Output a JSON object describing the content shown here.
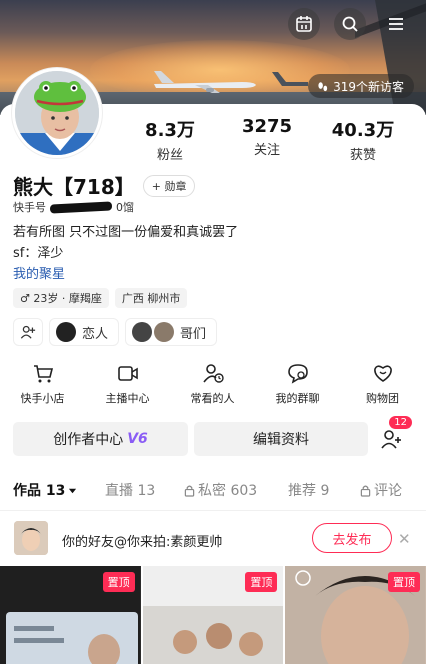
{
  "header": {
    "visitors_label": "319个新访客"
  },
  "profile": {
    "name": "熊大【718】",
    "medal_label": "+ 勋章",
    "kuaishou_id_prefix": "快手号",
    "kuaishou_id_suffix": "0馏",
    "bio_line1": "若有所图 只不过图一份偏爱和真诚罢了",
    "bio_line2": "sf：泽少",
    "my_collection": "我的聚星",
    "tags": [
      "♂ 23岁 · 摩羯座",
      "广西 柳州市"
    ],
    "friend_chips": [
      {
        "label": "恋人"
      },
      {
        "label": "哥们"
      }
    ]
  },
  "stats": [
    {
      "value": "8.3万",
      "label": "粉丝"
    },
    {
      "value": "3275",
      "label": "关注"
    },
    {
      "value": "40.3万",
      "label": "获赞"
    }
  ],
  "shortcuts": [
    {
      "label": "快手小店",
      "icon": "cart-icon"
    },
    {
      "label": "主播中心",
      "icon": "video-camera-icon"
    },
    {
      "label": "常看的人",
      "icon": "person-clock-icon"
    },
    {
      "label": "我的群聊",
      "icon": "chat-bubble-icon"
    },
    {
      "label": "购物团",
      "icon": "heart-bag-icon"
    }
  ],
  "actions": {
    "creator_center": "创作者中心",
    "creator_level": "V6",
    "edit_profile": "编辑资料",
    "add_friend_badge": "12"
  },
  "tabs": [
    {
      "label": "作品 13"
    },
    {
      "label": "直播 13"
    },
    {
      "label": "私密 603"
    },
    {
      "label": "推荐 9"
    },
    {
      "label": "评论"
    }
  ],
  "promo": {
    "text": "你的好友@你来拍:素颜更帅",
    "button": "去发布"
  },
  "grid": [
    {
      "pin": "置顶"
    },
    {
      "pin": "置顶"
    },
    {
      "pin": "置顶"
    }
  ],
  "colors": {
    "accent": "#fe2c55",
    "link": "#2a5db0",
    "creator_level": "#8a5cf5"
  }
}
